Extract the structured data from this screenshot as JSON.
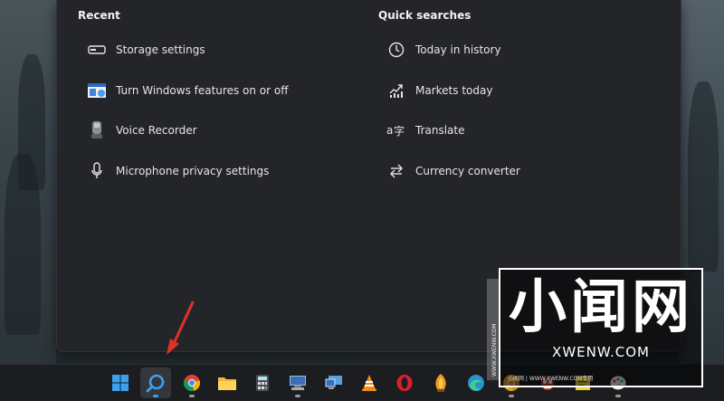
{
  "recent": {
    "title": "Recent",
    "items": [
      {
        "label": "Storage settings",
        "icon": "storage-icon"
      },
      {
        "label": "Turn Windows features on or off",
        "icon": "windows-features-icon"
      },
      {
        "label": "Voice Recorder",
        "icon": "voice-recorder-icon"
      },
      {
        "label": "Microphone privacy settings",
        "icon": "microphone-icon"
      }
    ]
  },
  "quick_searches": {
    "title": "Quick searches",
    "items": [
      {
        "label": "Today in history",
        "icon": "clock-icon"
      },
      {
        "label": "Markets today",
        "icon": "chart-icon"
      },
      {
        "label": "Translate",
        "icon": "translate-icon"
      },
      {
        "label": "Currency converter",
        "icon": "swap-arrows-icon"
      }
    ]
  },
  "taskbar": {
    "apps": [
      "start-icon",
      "search-icon",
      "chrome-icon",
      "file-explorer-icon",
      "calculator-icon",
      "network-icon",
      "remote-desktop-icon",
      "vlc-icon",
      "opera-icon",
      "fl-studio-icon",
      "edge-icon",
      "chrome-canary-icon",
      "game-icon",
      "sticky-notes-icon",
      "paint-icon"
    ]
  },
  "watermark": {
    "big_text": "小闻网",
    "site": "XWENW.COM",
    "small_text": "小闻网 | WWW.XWENW.COM专用",
    "vertical_text": "WWW.XWENW.COM"
  },
  "colors": {
    "panel": "#242528",
    "taskbar": "#1c1d20",
    "arrow": "#e0302a"
  }
}
